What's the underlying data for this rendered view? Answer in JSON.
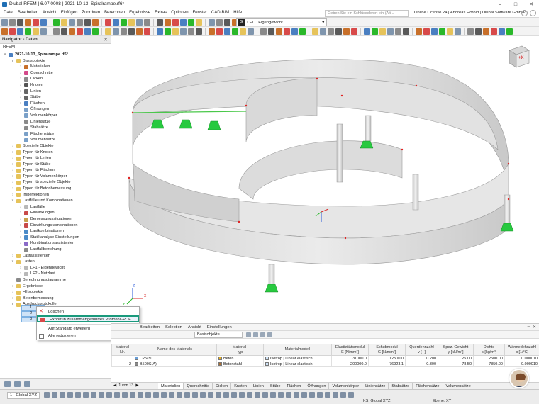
{
  "window": {
    "title": "Dlubal RFEM | 6.07.0008 | 2021-10-13_Spiralrampe.rf6*"
  },
  "menubar": {
    "items": [
      "Datei",
      "Bearbeiten",
      "Ansicht",
      "Einfügen",
      "Zuordnen",
      "Berechnen",
      "Ergebnisse",
      "Extras",
      "Optionen",
      "Fenster",
      "CAD-BIM",
      "Hilfe"
    ],
    "search_placeholder": "Geben Sie ein Schlüsselwort ein (Alt...",
    "license": "Online License 24 | Andreas Hörold | Dlubal Software GmbH"
  },
  "toolbar": {
    "load_case_code": "G",
    "load_case_id": "LF1",
    "load_case_name": "Eigengewicht"
  },
  "navigator": {
    "title": "Navigator - Daten",
    "root": "RFEM",
    "tree": [
      {
        "label": "2021-10-13_Spiralrampe.rf6*",
        "level": 0,
        "expanded": true,
        "bold": true,
        "icon": "model-icon",
        "color": "#4a7fc1"
      },
      {
        "label": "Basisobjekte",
        "level": 1,
        "expanded": true,
        "icon": "folder-icon",
        "color": "#e6c35a"
      },
      {
        "label": "Materialien",
        "level": 2,
        "expanded": false,
        "icon": "material-icon",
        "color": "#c8702a"
      },
      {
        "label": "Querschnitte",
        "level": 2,
        "expanded": false,
        "icon": "cross-section-icon",
        "color": "#d44a8a"
      },
      {
        "label": "Dicken",
        "level": 2,
        "expanded": false,
        "icon": "thickness-icon",
        "color": "#8a8a8a"
      },
      {
        "label": "Knoten",
        "level": 2,
        "expanded": false,
        "icon": "node-icon",
        "color": "#555555"
      },
      {
        "label": "Linien",
        "level": 2,
        "expanded": false,
        "icon": "line-icon",
        "color": "#666666"
      },
      {
        "label": "Stäbe",
        "level": 2,
        "expanded": false,
        "icon": "member-icon",
        "color": "#666666"
      },
      {
        "label": "Flächen",
        "level": 2,
        "expanded": false,
        "icon": "surface-icon",
        "color": "#4a7fc1"
      },
      {
        "label": "Öffnungen",
        "level": 2,
        "expanded": null,
        "icon": "opening-icon",
        "color": "#7aa0c8"
      },
      {
        "label": "Volumenkörper",
        "level": 2,
        "expanded": null,
        "icon": "solid-icon",
        "color": "#7aa0c8"
      },
      {
        "label": "Liniensätze",
        "level": 2,
        "expanded": null,
        "icon": "line-set-icon",
        "color": "#8a8a8a"
      },
      {
        "label": "Stabsätze",
        "level": 2,
        "expanded": null,
        "icon": "member-set-icon",
        "color": "#8a8a8a"
      },
      {
        "label": "Flächensätze",
        "level": 2,
        "expanded": null,
        "icon": "surface-set-icon",
        "color": "#7aa0c8"
      },
      {
        "label": "Volumensätze",
        "level": 2,
        "expanded": null,
        "icon": "solid-set-icon",
        "color": "#7aa0c8"
      },
      {
        "label": "Spezielle Objekte",
        "level": 1,
        "expanded": false,
        "icon": "folder-icon",
        "color": "#e6c35a"
      },
      {
        "label": "Typen für Knoten",
        "level": 1,
        "expanded": false,
        "icon": "folder-icon",
        "color": "#e6c35a"
      },
      {
        "label": "Typen für Linien",
        "level": 1,
        "expanded": false,
        "icon": "folder-icon",
        "color": "#e6c35a"
      },
      {
        "label": "Typen für Stäbe",
        "level": 1,
        "expanded": false,
        "icon": "folder-icon",
        "color": "#e6c35a"
      },
      {
        "label": "Typen für Flächen",
        "level": 1,
        "expanded": false,
        "icon": "folder-icon",
        "color": "#e6c35a"
      },
      {
        "label": "Typen für Volumenkörper",
        "level": 1,
        "expanded": false,
        "icon": "folder-icon",
        "color": "#e6c35a"
      },
      {
        "label": "Typen für spezielle Objekte",
        "level": 1,
        "expanded": false,
        "icon": "folder-icon",
        "color": "#e6c35a"
      },
      {
        "label": "Typen für Betonbemessung",
        "level": 1,
        "expanded": false,
        "icon": "folder-icon",
        "color": "#e6c35a"
      },
      {
        "label": "Imperfektionen",
        "level": 1,
        "expanded": false,
        "icon": "folder-icon",
        "color": "#e6c35a"
      },
      {
        "label": "Lastfälle und Kombinationen",
        "level": 1,
        "expanded": true,
        "icon": "folder-icon",
        "color": "#e6c35a"
      },
      {
        "label": "Lastfälle",
        "level": 2,
        "expanded": false,
        "icon": "load-case-icon",
        "color": "#b8b8b8"
      },
      {
        "label": "Einwirkungen",
        "level": 2,
        "expanded": false,
        "icon": "action-icon",
        "color": "#c84a4a"
      },
      {
        "label": "Bemessungssituationen",
        "level": 2,
        "expanded": false,
        "icon": "design-situation-icon",
        "color": "#c8a04a"
      },
      {
        "label": "Einwirkungskombinationen",
        "level": 2,
        "expanded": false,
        "icon": "action-combination-icon",
        "color": "#c84a4a"
      },
      {
        "label": "Lastkombinationen",
        "level": 2,
        "expanded": false,
        "icon": "load-combination-icon",
        "color": "#4a8ac8"
      },
      {
        "label": "Statikanalyse-Einstellungen",
        "level": 2,
        "expanded": false,
        "icon": "analysis-settings-icon",
        "color": "#4a8ac8"
      },
      {
        "label": "Kombinationsassistenten",
        "level": 2,
        "expanded": false,
        "icon": "wizard-icon",
        "color": "#8a6ac8"
      },
      {
        "label": "Lastfallbeziehung",
        "level": 2,
        "expanded": null,
        "icon": "relationship-icon",
        "color": "#8a8a8a"
      },
      {
        "label": "Lastassistenten",
        "level": 1,
        "expanded": false,
        "icon": "folder-icon",
        "color": "#e6c35a"
      },
      {
        "label": "Lasten",
        "level": 1,
        "expanded": true,
        "icon": "folder-icon",
        "color": "#e6c35a"
      },
      {
        "label": "LF1 - Eigengewicht",
        "level": 2,
        "expanded": false,
        "icon": "load-icon",
        "color": "#b8b8b8"
      },
      {
        "label": "LF2 - Nutzlast",
        "level": 2,
        "expanded": false,
        "icon": "load-icon",
        "color": "#b8b8b8"
      },
      {
        "label": "Berechnungsdiagramme",
        "level": 1,
        "expanded": null,
        "icon": "diagram-icon",
        "color": "#8a8a8a"
      },
      {
        "label": "Ergebnisse",
        "level": 1,
        "expanded": false,
        "icon": "folder-icon",
        "color": "#e6c35a"
      },
      {
        "label": "Hilfsobjekte",
        "level": 1,
        "expanded": false,
        "icon": "folder-icon",
        "color": "#e6c35a"
      },
      {
        "label": "Betonbemessung",
        "level": 1,
        "expanded": false,
        "icon": "folder-icon",
        "color": "#e6c35a"
      },
      {
        "label": "Ausdruckprotokolle",
        "level": 1,
        "expanded": true,
        "icon": "folder-icon",
        "color": "#e6c35a"
      }
    ],
    "selected_reports": [
      "1",
      "2",
      "3"
    ]
  },
  "context_menu": {
    "items": [
      {
        "label": "Löschen",
        "icon": "delete-icon",
        "highlighted": false
      },
      {
        "label": "Export in zusammengeführtes Protokoll-PDF",
        "icon": "pdf-export-icon",
        "highlighted": true
      },
      {
        "label": "Auf Standard erweitern",
        "icon": "",
        "highlighted": false
      },
      {
        "label": "Alle reduzieren",
        "icon": "collapse-icon",
        "highlighted": false
      }
    ]
  },
  "viewport": {
    "cube_label": "+X",
    "axes": {
      "x": "X",
      "y": "Y",
      "z": "Z"
    }
  },
  "table_panel": {
    "menus": [
      "Bearbeiten",
      "Selektion",
      "Ansicht",
      "Einstellungen"
    ],
    "category": "Basisobjekte",
    "columns": [
      {
        "label": "Material\nNr."
      },
      {
        "label": "Name des Materials"
      },
      {
        "label": "Material-\ntyp"
      },
      {
        "label": "Materialmodell"
      },
      {
        "label": "Elastizitätsmodul\nE [N/mm²]"
      },
      {
        "label": "Schubmodul\nG [N/mm²]"
      },
      {
        "label": "Querdehnzahl\nν [--]"
      },
      {
        "label": "Spez. Gewicht\nγ [kN/m³]"
      },
      {
        "label": "Dichte\nρ [kg/m³]"
      },
      {
        "label": "Wärmedehnzahl\nα [1/°C]"
      }
    ],
    "rows": [
      {
        "nr": "1",
        "name": "C25/30",
        "name_color": "#6a9fd8",
        "type": "Beton",
        "type_color": "#e8b020",
        "model": "Isotrop | Linear elastisch",
        "e": "31000.0",
        "g": "12500.0",
        "nu": "0.200",
        "gamma": "25.00",
        "rho": "2500.00",
        "alpha": "0.000010"
      },
      {
        "nr": "2",
        "name": "B500S(A)",
        "name_color": "#8a8a8a",
        "type": "Betonstahl",
        "type_color": "#b07030",
        "model": "Isotrop | Linear elastisch",
        "e": "200000.0",
        "g": "76923.1",
        "nu": "0.300",
        "gamma": "78.50",
        "rho": "7850.00",
        "alpha": "0.000010"
      }
    ]
  },
  "bottom_tabs": {
    "pager": "1 von 13",
    "tabs": [
      "Materialien",
      "Querschnitte",
      "Dicken",
      "Knoten",
      "Linien",
      "Stäbe",
      "Flächen",
      "Öffnungen",
      "Volumenkörper",
      "Liniensätze",
      "Stabsätze",
      "Flächensätze",
      "Volumensätze"
    ],
    "active": "Materialien"
  },
  "statusbar": {
    "coordinate_system": "1 - Global XYZ",
    "ks": "KS: Global XYZ",
    "ebene": "Ebene: XY"
  },
  "colors": {
    "accent": "#1a9a7c",
    "support": "#27c93f",
    "node": "#e02020"
  }
}
